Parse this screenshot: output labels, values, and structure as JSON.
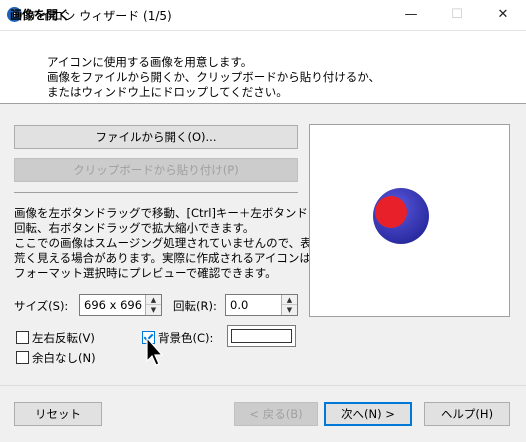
{
  "window": {
    "title": "アイコン ウィザード (1/5)",
    "app_icon_glyph": "i"
  },
  "window_controls": {
    "minimize": "—",
    "maximize": "☐",
    "close": "✕"
  },
  "header": {
    "title": "画像を開く",
    "lines": [
      "アイコンに使用する画像を用意します。",
      "画像をファイルから開くか、クリップボードから貼り付けるか、",
      "またはウィンドウ上にドロップしてください。"
    ]
  },
  "buttons": {
    "open_file": "ファイルから開く(O)...",
    "paste_clipboard": "クリップボードから貼り付け(P)",
    "reset": "リセット",
    "back": "< 戻る(B)",
    "next": "次へ(N) >",
    "help": "ヘルプ(H)"
  },
  "description": [
    "画像を左ボタンドラッグで移動、[Ctrl]キー＋左ボタンドラッグで",
    "回転、右ボタンドラッグで拡大縮小できます。",
    "ここでの画像はスムージング処理されていませんので、表示が",
    "荒く見える場合があります。実際に作成されるアイコンは、画像",
    "フォーマット選択時にプレビューで確認できます。"
  ],
  "size": {
    "label": "サイズ(S):",
    "value": "696 x 696"
  },
  "rotation": {
    "label": "回転(R):",
    "value": "0.0"
  },
  "checkboxes": {
    "flip_horizontal": {
      "label": "左右反転(V)",
      "checked": false
    },
    "background_color": {
      "label": "背景色(C):",
      "checked": true
    },
    "no_margin": {
      "label": "余白なし(N)",
      "checked": false
    }
  },
  "colors": {
    "accent": "#0078d7",
    "preview_outer_circle": "#3b3bc4",
    "preview_inner_circle": "#e8202a",
    "background_swatch": "#ffffff"
  },
  "icons": {
    "app": "info-icon",
    "spin_up": "chevron-up-icon",
    "spin_down": "chevron-down-icon",
    "cursor": "mouse-pointer-icon"
  }
}
